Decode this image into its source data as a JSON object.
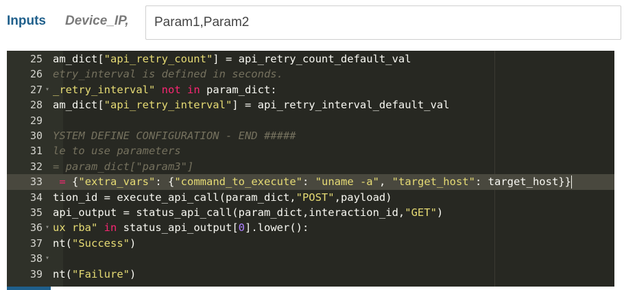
{
  "form": {
    "inputs_label": "Inputs",
    "device_ip_label": "Device_IP,",
    "param_value": "Param1,Param2"
  },
  "editor": {
    "theme": "monokai",
    "lines": [
      {
        "num": "25",
        "fold": "",
        "active": false,
        "tokens": [
          {
            "t": "am_dict[",
            "c": "plain"
          },
          {
            "t": "\"api_retry_count\"",
            "c": "str"
          },
          {
            "t": "] = api_retry_count_default_val",
            "c": "plain"
          }
        ]
      },
      {
        "num": "26",
        "fold": "",
        "active": false,
        "tokens": [
          {
            "t": "etry_interval is defined in seconds.",
            "c": "cmt"
          }
        ]
      },
      {
        "num": "27",
        "fold": "▾",
        "active": false,
        "tokens": [
          {
            "t": "_retry_interval\"",
            "c": "str"
          },
          {
            "t": " ",
            "c": "plain"
          },
          {
            "t": "not in",
            "c": "kw"
          },
          {
            "t": " param_dict:",
            "c": "plain"
          }
        ]
      },
      {
        "num": "28",
        "fold": "",
        "active": false,
        "tokens": [
          {
            "t": "am_dict[",
            "c": "plain"
          },
          {
            "t": "\"api_retry_interval\"",
            "c": "str"
          },
          {
            "t": "] = api_retry_interval_default_val",
            "c": "plain"
          }
        ]
      },
      {
        "num": "29",
        "fold": "",
        "active": false,
        "tokens": []
      },
      {
        "num": "30",
        "fold": "",
        "active": false,
        "tokens": [
          {
            "t": "YSTEM DEFINE CONFIGURATION - END #####",
            "c": "cmt"
          }
        ]
      },
      {
        "num": "31",
        "fold": "",
        "active": false,
        "tokens": [
          {
            "t": "le to use parameters",
            "c": "cmt"
          }
        ]
      },
      {
        "num": "32",
        "fold": "",
        "active": false,
        "tokens": [
          {
            "t": "= param_dict[\"param3\"]",
            "c": "cmt"
          }
        ]
      },
      {
        "num": "33",
        "fold": "",
        "active": true,
        "tokens": [
          {
            "t": " ",
            "c": "plain"
          },
          {
            "t": "=",
            "c": "kw"
          },
          {
            "t": " {",
            "c": "plain"
          },
          {
            "t": "\"extra_vars\"",
            "c": "str"
          },
          {
            "t": ": {",
            "c": "plain"
          },
          {
            "t": "\"command_to_execute\"",
            "c": "str"
          },
          {
            "t": ": ",
            "c": "plain"
          },
          {
            "t": "\"uname -a\"",
            "c": "str"
          },
          {
            "t": ", ",
            "c": "plain"
          },
          {
            "t": "\"target_host\"",
            "c": "str"
          },
          {
            "t": ": target_host}}",
            "c": "plain"
          }
        ]
      },
      {
        "num": "34",
        "fold": "",
        "active": false,
        "tokens": [
          {
            "t": "tion_id = execute_api_call(param_dict,",
            "c": "plain"
          },
          {
            "t": "\"POST\"",
            "c": "str"
          },
          {
            "t": ",payload)",
            "c": "plain"
          }
        ]
      },
      {
        "num": "35",
        "fold": "",
        "active": false,
        "tokens": [
          {
            "t": "api_output = status_api_call(param_dict,interaction_id,",
            "c": "plain"
          },
          {
            "t": "\"GET\"",
            "c": "str"
          },
          {
            "t": ")",
            "c": "plain"
          }
        ]
      },
      {
        "num": "36",
        "fold": "▾",
        "active": false,
        "tokens": [
          {
            "t": "ux rba\"",
            "c": "str"
          },
          {
            "t": " ",
            "c": "plain"
          },
          {
            "t": "in",
            "c": "kw"
          },
          {
            "t": " status_api_output[",
            "c": "plain"
          },
          {
            "t": "0",
            "c": "num"
          },
          {
            "t": "].lower():",
            "c": "plain"
          }
        ]
      },
      {
        "num": "37",
        "fold": "",
        "active": false,
        "tokens": [
          {
            "t": "nt(",
            "c": "plain"
          },
          {
            "t": "\"Success\"",
            "c": "str"
          },
          {
            "t": ")",
            "c": "plain"
          }
        ]
      },
      {
        "num": "38",
        "fold": "▾",
        "active": false,
        "tokens": []
      },
      {
        "num": "39",
        "fold": "",
        "active": false,
        "tokens": [
          {
            "t": "nt(",
            "c": "plain"
          },
          {
            "t": "\"Failure\"",
            "c": "str"
          },
          {
            "t": ")",
            "c": "plain"
          }
        ]
      }
    ]
  }
}
